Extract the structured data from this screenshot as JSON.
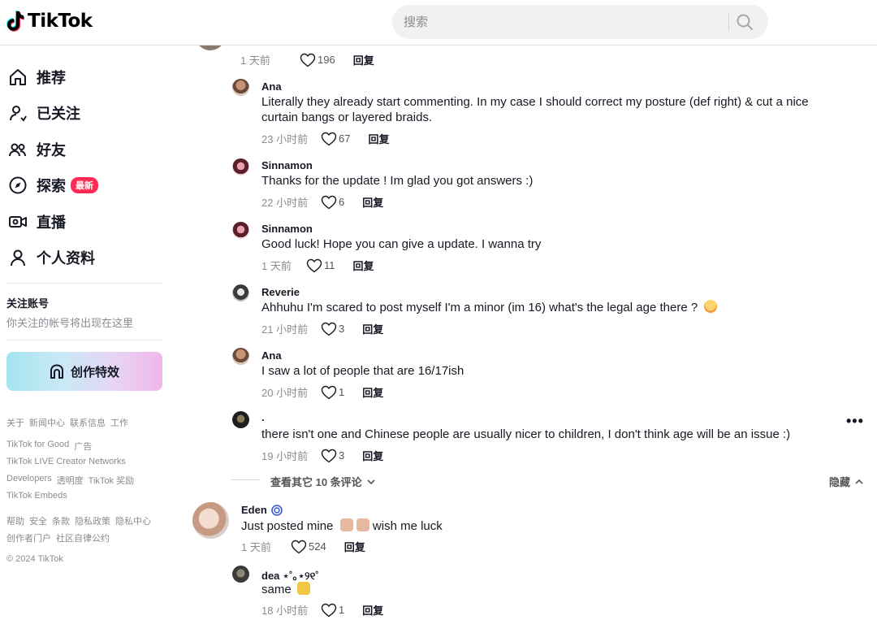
{
  "header": {
    "logo_text": "TikTok",
    "search_placeholder": "搜索"
  },
  "sidebar": {
    "nav": [
      {
        "label": "推荐",
        "icon": "home-icon"
      },
      {
        "label": "已关注",
        "icon": "following-icon"
      },
      {
        "label": "好友",
        "icon": "friends-icon"
      },
      {
        "label": "探索",
        "icon": "explore-icon",
        "badge": "最新"
      },
      {
        "label": "直播",
        "icon": "live-icon"
      },
      {
        "label": "个人资料",
        "icon": "profile-icon"
      }
    ],
    "following_title": "关注账号",
    "following_empty": "你关注的帐号将出现在这里",
    "create_label": "创作特效",
    "footer_rows": [
      [
        "关于",
        "新闻中心",
        "联系信息",
        "工作"
      ],
      [
        "TikTok for Good",
        "广告"
      ],
      [
        "TikTok LIVE Creator Networks"
      ],
      [
        "Developers",
        "透明度",
        "TikTok 奖励"
      ],
      [
        "TikTok Embeds"
      ],
      [
        "帮助",
        "安全",
        "条款",
        "隐私政策",
        "隐私中心"
      ],
      [
        "创作者门户",
        "社区自律公约"
      ]
    ],
    "copyright": "© 2024 TikTok"
  },
  "comments": [
    {
      "name": "",
      "text": "",
      "time": "1 天前",
      "likes": "196",
      "reply": "回复"
    },
    {
      "name": "Ana",
      "text": "Literally they already start commenting. In my case I should correct my posture (def right) & cut a nice curtain bangs or layered braids.",
      "time": "23 小时前",
      "likes": "67",
      "reply": "回复"
    },
    {
      "name": "Sinnamon",
      "text": "Thanks for the update ! Im glad you got answers :)",
      "time": "22 小时前",
      "likes": "6",
      "reply": "回复"
    },
    {
      "name": "Sinnamon",
      "text": "Good luck! Hope you can give a update. I wanna try",
      "time": "1 天前",
      "likes": "11",
      "reply": "回复"
    },
    {
      "name": "Reverie",
      "text": "Ahhuhu I'm scared to post myself I'm a minor (im 16) what's the legal age there ?",
      "time": "21 小时前",
      "likes": "3",
      "reply": "回复"
    },
    {
      "name": "Ana",
      "text": "I saw a lot of people that are 16/17ish",
      "time": "20 小时前",
      "likes": "1",
      "reply": "回复"
    },
    {
      "name": ".",
      "text": "there isn't one and Chinese people are usually nicer to children, I don't think age will be an issue :)",
      "time": "19 小时前",
      "likes": "3",
      "reply": "回复"
    },
    {
      "name": "Eden",
      "text": "Just posted mine",
      "text_suffix": "wish me luck",
      "time": "1 天前",
      "likes": "524",
      "reply": "回复"
    },
    {
      "name": "dea ⋆˚｡⋆୨୧˚",
      "text": "same",
      "time": "18 小时前",
      "likes": "1",
      "reply": "回复"
    }
  ],
  "view_more": "查看其它 10 条评论",
  "hide_label": "隐藏",
  "colors": {
    "accent": "#fe2c55",
    "text": "#161823",
    "muted": "#8a8b91"
  }
}
